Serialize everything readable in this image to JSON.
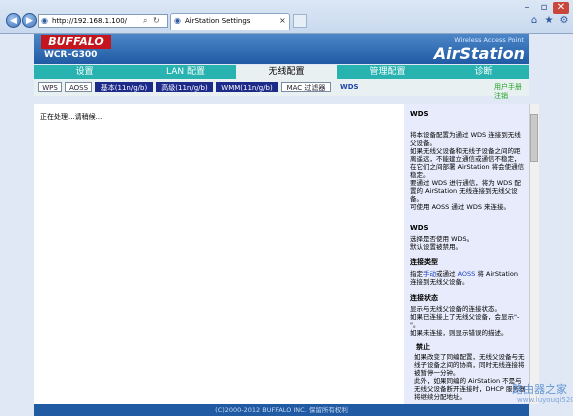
{
  "browser": {
    "url": "http://192.168.1.100/",
    "tab_title": "AirStation Settings"
  },
  "header": {
    "logo": "BUFFALO",
    "model": "WCR-G300",
    "subtitle": "Wireless Access Point",
    "brand": "AirStation"
  },
  "menu": {
    "tabs": [
      {
        "label": "设置"
      },
      {
        "label": "LAN 配置"
      },
      {
        "label": "无线配置"
      },
      {
        "label": "管理配置"
      },
      {
        "label": "诊断"
      }
    ]
  },
  "submenu": {
    "items": [
      {
        "label": "WPS"
      },
      {
        "label": "AOSS"
      },
      {
        "label": "基本(11n/g/b)"
      },
      {
        "label": "高级(11n/g/b)"
      },
      {
        "label": "WMM(11n/g/b)"
      },
      {
        "label": "MAC 过滤器"
      },
      {
        "label": "WDS"
      }
    ],
    "manual": "用户手册",
    "logout": "注销"
  },
  "main": {
    "status": "正在处理...请稍候..."
  },
  "help": {
    "title": "WDS",
    "intro": "将本设备配置为通过 WDS 连接到无线父设备。\n如果无线父设备和无线子设备之间的距离遥远，不能建立通信或通信不稳定，在它们之间部署 AirStation 将会使通信稳定。\n要通过 WDS 进行通信，将为 WDS 配置的 AirStation 无线连接到无线父设备。\n可使用 AOSS 通过 WDS 来连接。",
    "wds_title": "WDS",
    "wds_text": "选择是否使用 WDS。\n默认设置被禁用。",
    "conn_title": "连接类型",
    "conn_pre": "指定",
    "conn_link1": "手动",
    "conn_mid": "或通过 ",
    "conn_link2": "AOSS",
    "conn_post": " 将 AirStation 连接到无线父设备。",
    "status_title": "连接状态",
    "status_text": "显示与无线父设备的连接状态。\n如果已连接上了无线父设备，会显示\"-\"。\n如果未连接，则显示错误的描述。",
    "disable_title": "禁止",
    "disable_text": "如果改变了同编配置，无线父设备与无线子设备之间的协商，同时无线连接将被暂停一分钟。\n此外，如果同编的 AirStation 不是与无线父设备断开连接时，DHCP 服务器将继续分配地址。"
  },
  "footer": {
    "copyright": "(C)2000-2012 BUFFALO INC. 保留所有权利"
  },
  "watermark": {
    "line1": "路由器之家",
    "line2": "www.luyouqi520.com"
  }
}
